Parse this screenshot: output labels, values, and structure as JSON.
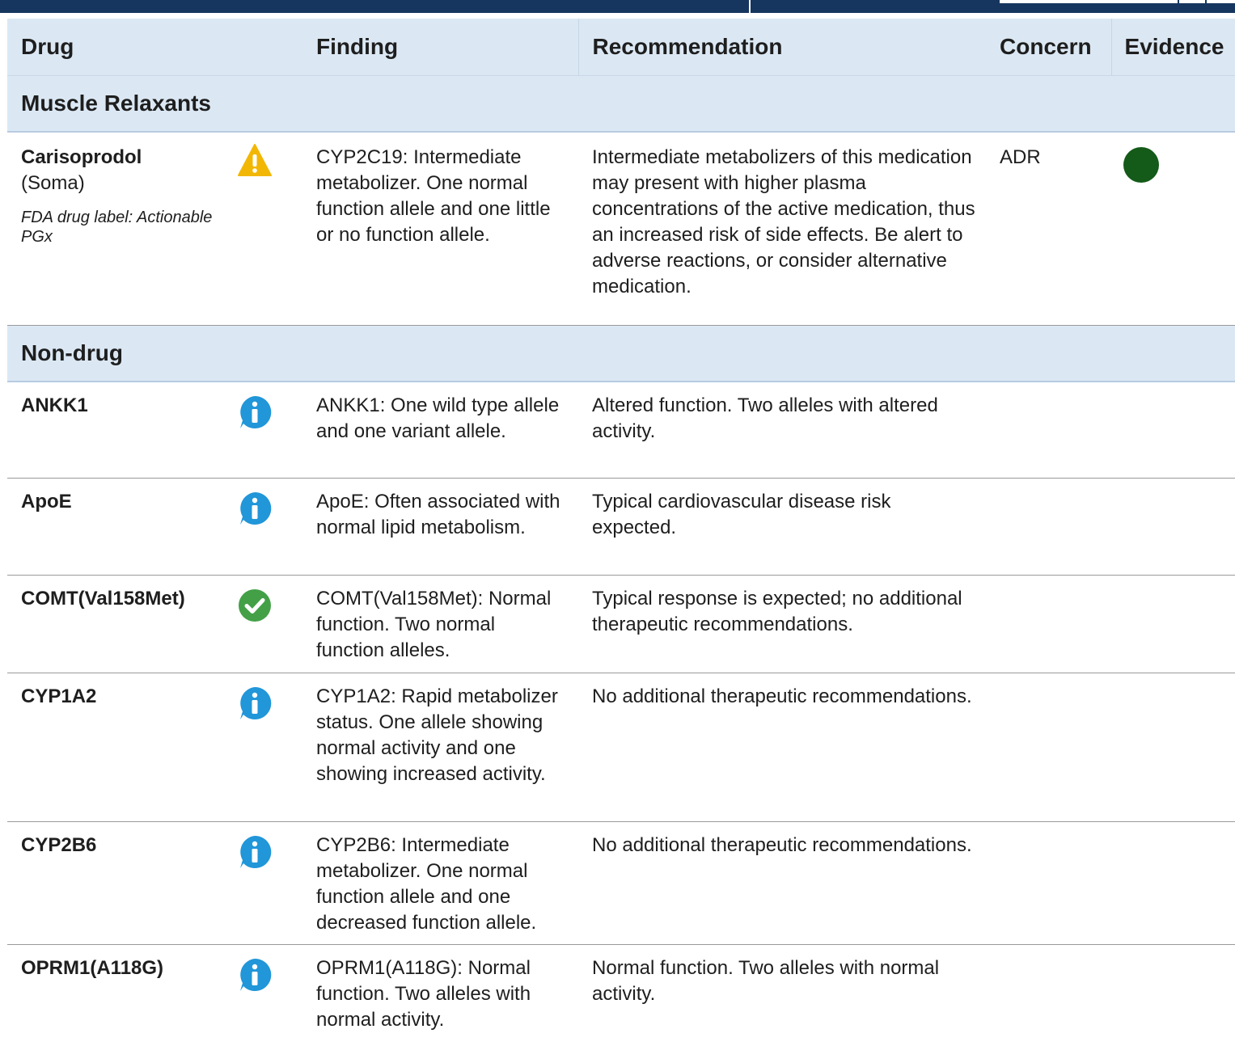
{
  "colors": {
    "header_bg": "#dbe8f4",
    "top_bar": "#16365f",
    "warning": "#f2b705",
    "info": "#2196d9",
    "check": "#43a047",
    "evidence_strong": "#145a19"
  },
  "table": {
    "headers": {
      "drug": "Drug",
      "finding": "Finding",
      "recommendation": "Recommendation",
      "concern": "Concern",
      "evidence": "Evidence"
    },
    "sections": [
      {
        "title": "Muscle Relaxants",
        "rows": [
          {
            "drug": "Carisoprodol",
            "brand": "(Soma)",
            "fda": "FDA drug label: Actionable PGx",
            "icon": "warning-icon",
            "finding": "CYP2C19: Intermediate metabolizer. One normal function allele and one little or no function allele.",
            "recommendation": "Intermediate metabolizers of this medication may present with higher plasma concentrations of the active medication, thus an increased risk of side effects. Be alert to adverse reactions, or consider alternative medication.",
            "concern": "ADR",
            "evidence": "strong"
          }
        ]
      },
      {
        "title": "Non-drug",
        "rows": [
          {
            "drug": "ANKK1",
            "icon": "info-icon",
            "finding": "ANKK1: One wild type allele and one variant allele.",
            "recommendation": "Altered function. Two alleles with altered activity."
          },
          {
            "drug": "ApoE",
            "icon": "info-icon",
            "finding": "ApoE: Often associated with normal lipid metabolism.",
            "recommendation": "Typical cardiovascular disease risk expected."
          },
          {
            "drug": "COMT(Val158Met)",
            "icon": "check-icon",
            "finding": "COMT(Val158Met): Normal function. Two normal function alleles.",
            "recommendation": "Typical response is expected; no additional therapeutic recommendations."
          },
          {
            "drug": "CYP1A2",
            "icon": "info-icon",
            "finding": "CYP1A2: Rapid metabolizer status. One allele showing normal activity and one showing increased activity.",
            "recommendation": "No additional therapeutic recommendations."
          },
          {
            "drug": "CYP2B6",
            "icon": "info-icon",
            "finding": "CYP2B6: Intermediate metabolizer. One normal function allele and one decreased function allele.",
            "recommendation": "No additional therapeutic recommendations."
          },
          {
            "drug": "OPRM1(A118G)",
            "icon": "info-icon",
            "finding": "OPRM1(A118G): Normal function. Two alleles with normal activity.",
            "recommendation": "Normal function. Two alleles with normal activity."
          }
        ]
      }
    ]
  }
}
